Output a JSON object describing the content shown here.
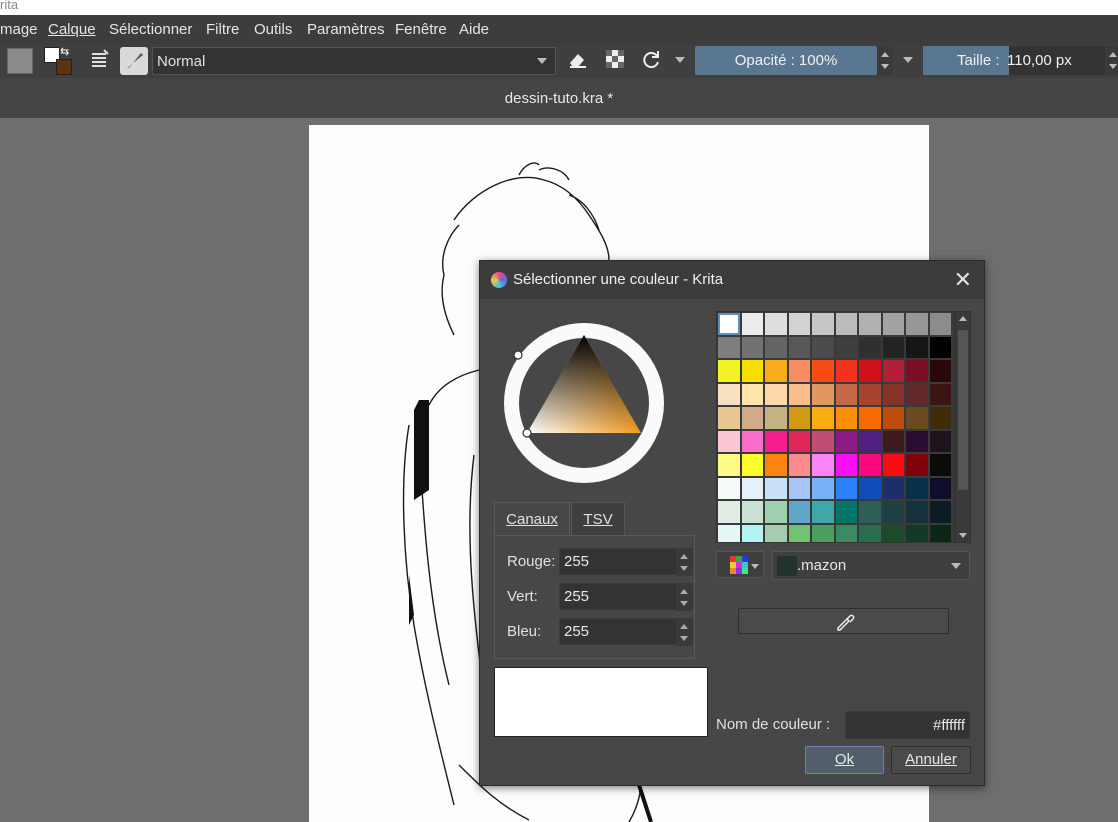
{
  "window": {
    "title_fragment": "rita"
  },
  "menu": [
    {
      "label": "mage"
    },
    {
      "label": "Calque"
    },
    {
      "label": "Sélectionner"
    },
    {
      "label": "Filtre"
    },
    {
      "label": "Outils"
    },
    {
      "label": "Paramètres"
    },
    {
      "label": "Fenêtre"
    },
    {
      "label": "Aide"
    }
  ],
  "toolbar": {
    "blend_mode": "Normal",
    "opacity_label": "Opacité : 100%",
    "opacity_value": 1.0,
    "size_label": "Taille :",
    "size_value": "110,00 px"
  },
  "document": {
    "tab_title": "dessin-tuto.kra *"
  },
  "dialog": {
    "title": "Sélectionner une couleur - Krita",
    "tabs": [
      {
        "label": "Canaux"
      },
      {
        "label": "TSV"
      }
    ],
    "channels": [
      {
        "label": "Rouge:",
        "value": "255"
      },
      {
        "label": "Vert:",
        "value": "255"
      },
      {
        "label": "Bleu:",
        "value": "255"
      }
    ],
    "palette_name": ".mazon",
    "color_name_label": "Nom de couleur :",
    "color_name_value": "#ffffff",
    "ok_label": "Ok",
    "cancel_label": "Annuler",
    "preview_color": "#ffffff",
    "palette_colors": [
      [
        "#ffffff",
        "#ececec",
        "#dedede",
        "#d2d2d2",
        "#c6c6c6",
        "#bbbbbb",
        "#b0b0b0",
        "#a3a3a3",
        "#979797",
        "#8c8c8c"
      ],
      [
        "#7e7e7e",
        "#727272",
        "#656565",
        "#585858",
        "#4b4b4b",
        "#3f3f3f",
        "#303030",
        "#232323",
        "#161616",
        "#000000"
      ],
      [
        "#f2f224",
        "#f6e000",
        "#f8ab1c",
        "#f98d62",
        "#f74a14",
        "#f4311c",
        "#cf1019",
        "#b11f38",
        "#7b0f26",
        "#2a0708"
      ],
      [
        "#f6e0c0",
        "#ffe4a9",
        "#ffd8a9",
        "#fbbd8a",
        "#e3965e",
        "#c76947",
        "#a74331",
        "#85322b",
        "#63282a",
        "#3d1414"
      ],
      [
        "#e8c795",
        "#d1ab89",
        "#c4b283",
        "#d29912",
        "#faac12",
        "#fb8f0a",
        "#f76b01",
        "#bf4b0c",
        "#6c4a20",
        "#412b09"
      ],
      [
        "#fbc7d5",
        "#f96ecb",
        "#f51c8d",
        "#df2859",
        "#c14c74",
        "#8e1a86",
        "#4f2082",
        "#3c1a1f",
        "#2a0d30",
        "#1d121d"
      ],
      [
        "#fffa87",
        "#fffc2b",
        "#ff8310",
        "#fd8a8e",
        "#fc84f9",
        "#fa0ff5",
        "#fb0a7f",
        "#fb0b13",
        "#800309",
        "#0b0b09"
      ],
      [
        "#f5fbfa",
        "#e4f1fb",
        "#c8e1f7",
        "#a5c4f8",
        "#7ab2f8",
        "#2c81f8",
        "#0e4dba",
        "#1b2f6a",
        "#07304b",
        "#0e0e2c"
      ],
      [
        "#e0ece4",
        "#cbe1d4",
        "#9dcfb0",
        "#61a6c8",
        "#40a7a9",
        "#00766a",
        "#2d5e57",
        "#1e4043",
        "#153139",
        "#0d1b22"
      ],
      [
        "#e3f7f6",
        "#b6f1f6",
        "#a6ccb0",
        "#73c273",
        "#4a9f5e",
        "#3a8b61",
        "#2b6e4f",
        "#1b4b2a",
        "#133a27",
        "#0b2717"
      ]
    ]
  }
}
